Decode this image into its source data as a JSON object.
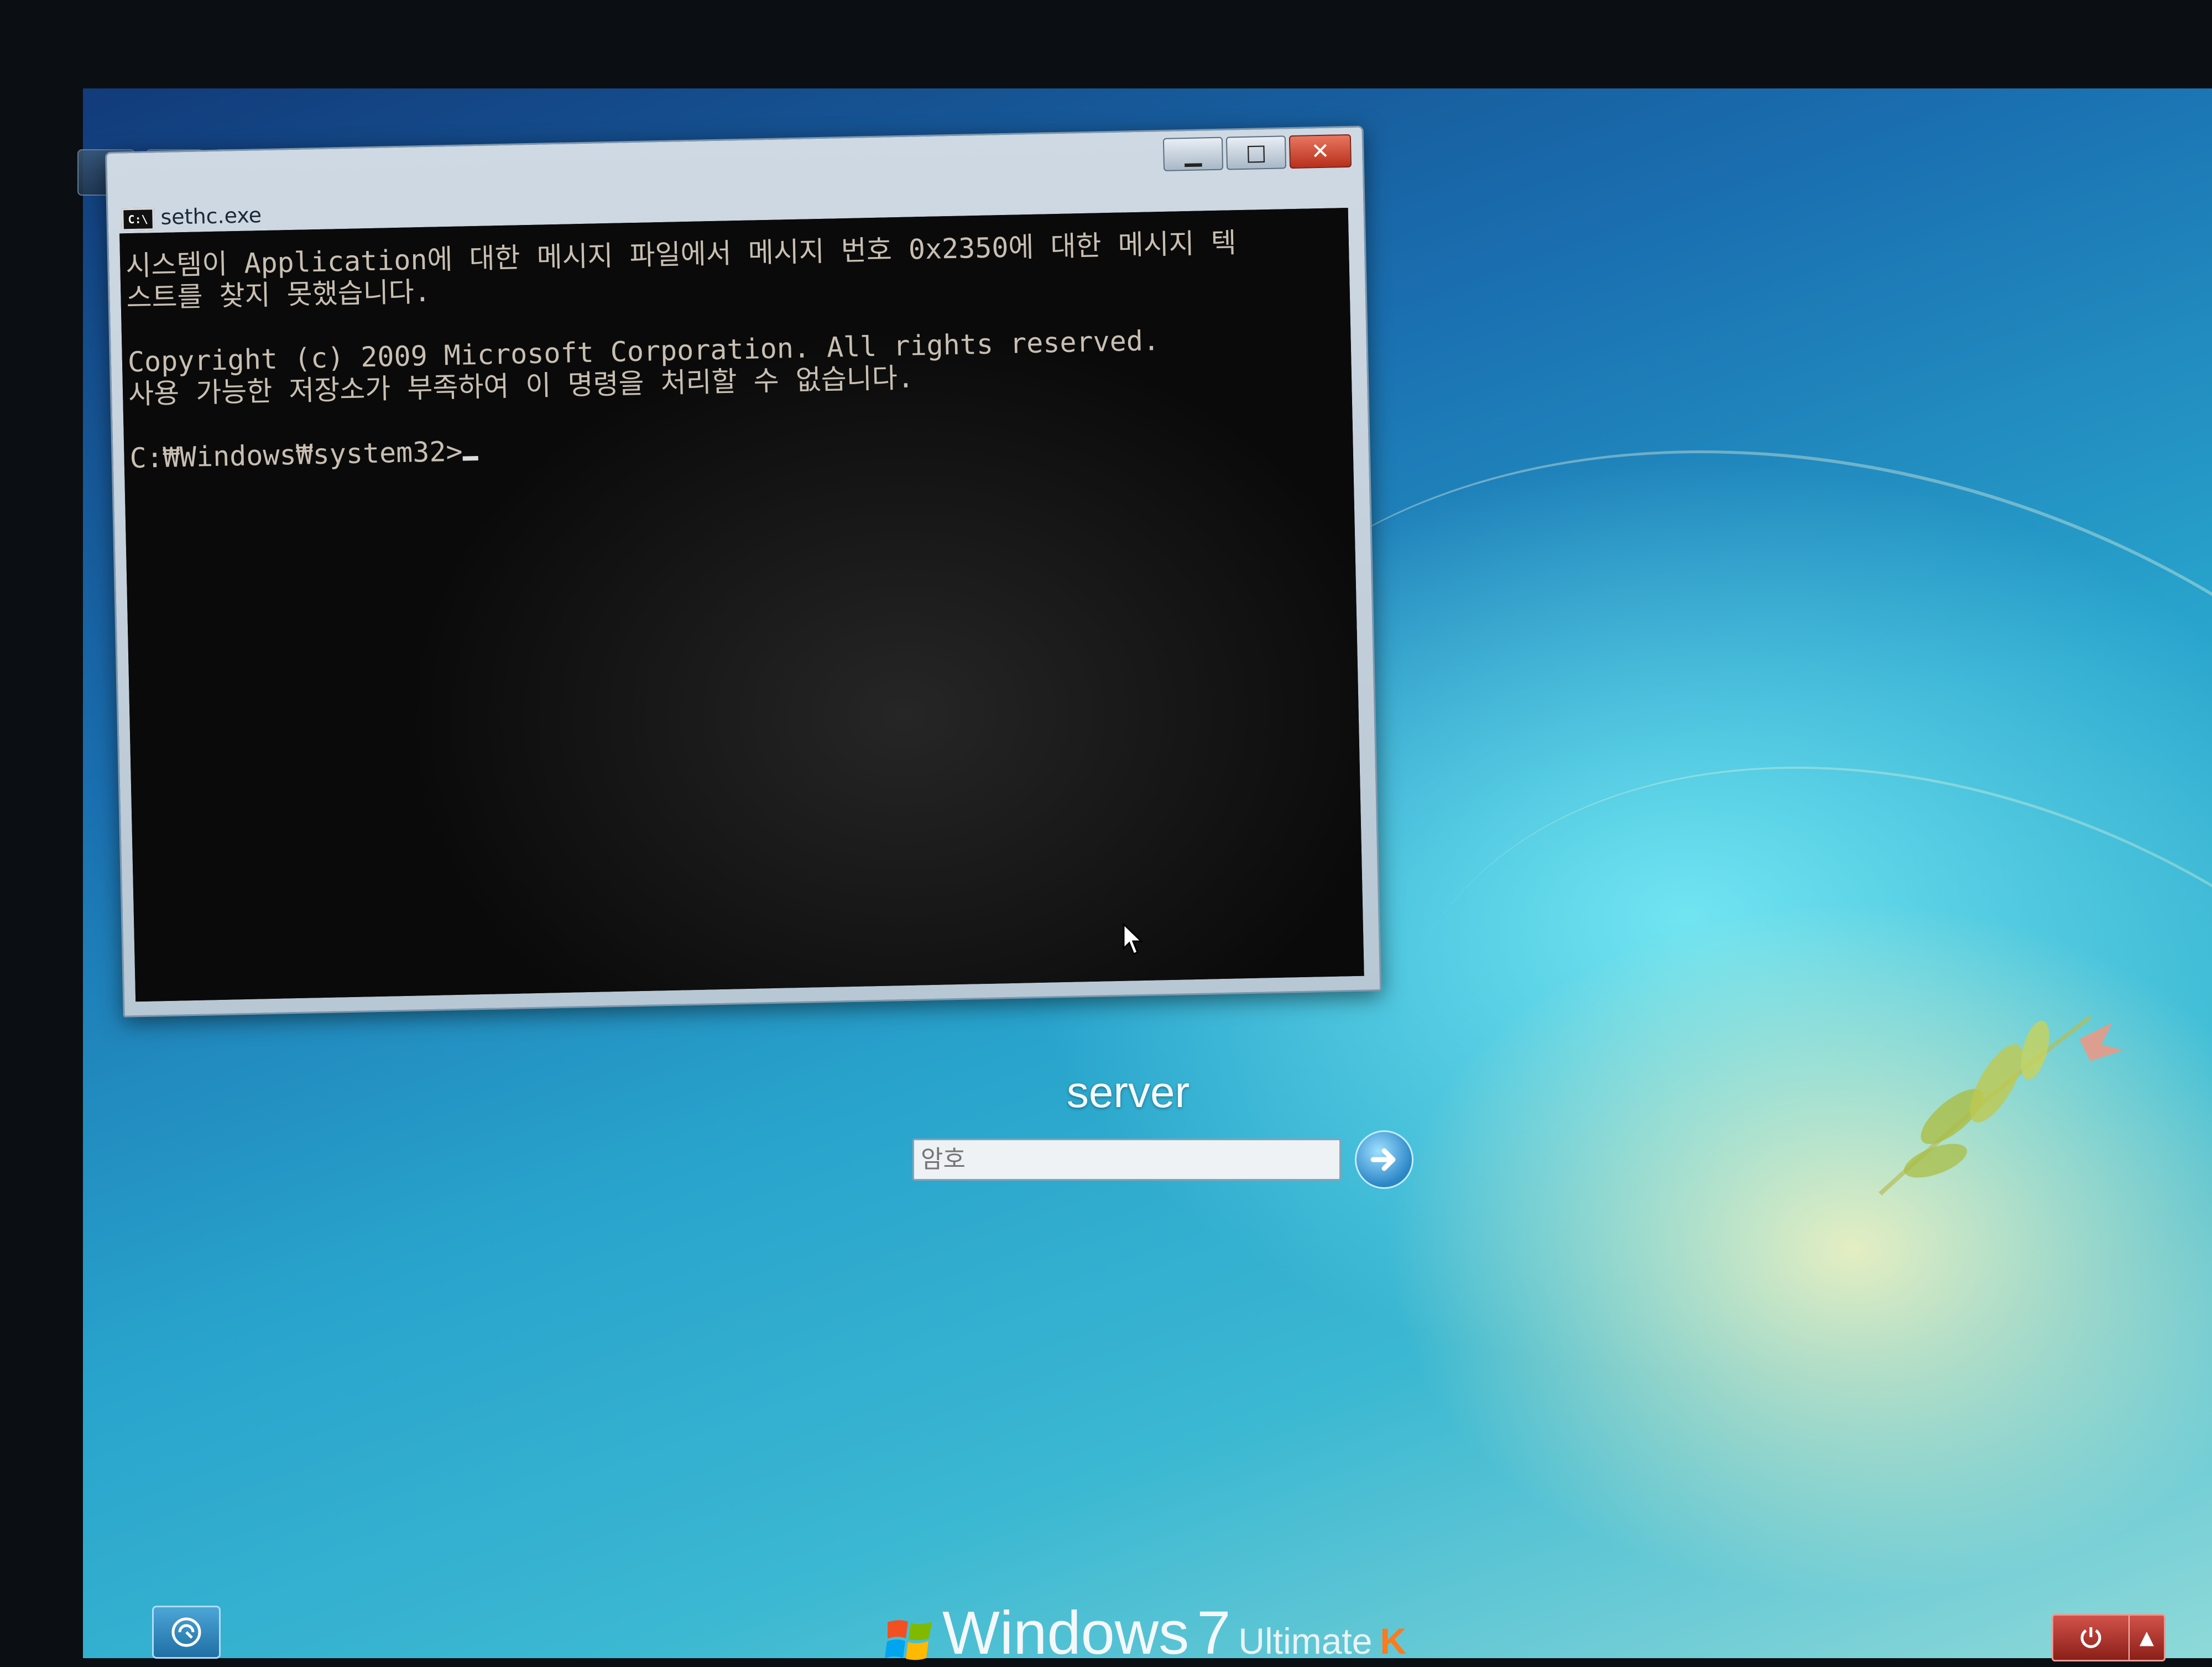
{
  "console": {
    "title": "sethc.exe",
    "icon": "cmd-icon",
    "icon_text": "C:\\",
    "buttons": {
      "minimize": "minimize-icon",
      "maximize": "maximize-icon",
      "close": "close-icon"
    },
    "lines": [
      "시스템이 Application에 대한 메시지 파일에서 메시지 번호 0x2350에 대한 메시지 텍",
      "스트를 찾지 못했습니다.",
      "",
      "Copyright (c) 2009 Microsoft Corporation. All rights reserved.",
      "사용 가능한 저장소가 부족하여 이 명령을 처리할 수 없습니다.",
      "",
      "C:₩Windows₩system32>"
    ]
  },
  "login": {
    "username": "server",
    "password_placeholder": "암호",
    "submit_icon": "arrow-right-icon"
  },
  "footer": {
    "ease_of_access_icon": "ease-of-access-icon",
    "brand": {
      "name": "Windows",
      "version": "7",
      "edition": "Ultimate",
      "suffix": "K"
    },
    "power_icon": "power-icon",
    "power_menu_icon": "chevron-up-icon"
  },
  "colors": {
    "console_bg": "#121212",
    "console_text": "#c8bfb2",
    "close": "#c9432c",
    "brand_suffix": "#ff7a1a"
  }
}
